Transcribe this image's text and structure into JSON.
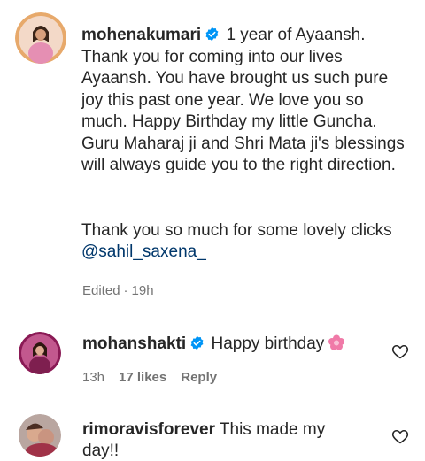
{
  "post_caption": {
    "username": "mohenakumari",
    "paragraph_1": "1 year of Ayaansh. Thank you for coming into our lives Ayaansh. You have brought us such pure joy this past one year. We love you so much. Happy Birthday my little Guncha. Guru Maharaj ji and Shri Mata ji's blessings will always guide you to the right direction.",
    "paragraph_2_text": "Thank you so much for some lovely clicks ",
    "mention": "@sahil_saxena_",
    "edited_label": "Edited",
    "separator": "·",
    "time": "19h"
  },
  "comments": [
    {
      "username": "mohanshakti",
      "text": "Happy birthday",
      "emoji": "flower-emoji",
      "time": "13h",
      "likes": "17 likes",
      "reply_label": "Reply"
    },
    {
      "username": "rimoravisforever",
      "text": "This made my day!!"
    }
  ],
  "icons": {
    "verified": "verified-badge-icon",
    "like": "heart-outline-icon"
  },
  "colors": {
    "verified_blue": "#0095f6",
    "mention_link": "#00376b",
    "meta_gray": "#737373"
  }
}
